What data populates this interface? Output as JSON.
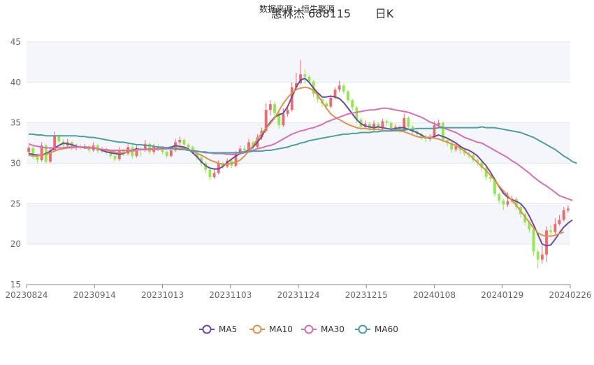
{
  "header": {
    "source_text": "数据来源：恒生聚源",
    "title": "惠林杰 688115",
    "period": "日K"
  },
  "colors": {
    "up": "#f0696c",
    "down": "#90ea4a",
    "ma5": "#6a4ba0",
    "ma10": "#e0924a",
    "ma30": "#d86eb4",
    "ma60": "#4aa0a0",
    "band": "#f5f6fb",
    "grid": "#e3e6ef",
    "axis_text": "#666666"
  },
  "chart_data": {
    "type": "candlestick",
    "title": "惠林杰 688115",
    "xlabel": "",
    "ylabel": "",
    "ylim": [
      15,
      45
    ],
    "y_ticks": [
      15,
      20,
      25,
      30,
      35,
      40,
      45
    ],
    "x_tick_labels": [
      "20230824",
      "20230914",
      "20231013",
      "20231103",
      "20231124",
      "20231215",
      "20240108",
      "20240129",
      "20240226"
    ],
    "legend": [
      "MA5",
      "MA10",
      "MA30",
      "MA60"
    ],
    "legend_position": "bottom",
    "candles": [
      [
        31.4,
        31.9,
        32.2,
        31.1
      ],
      [
        31.9,
        30.8,
        32.1,
        30.5
      ],
      [
        30.8,
        30.4,
        31.2,
        30.0
      ],
      [
        30.4,
        32.2,
        32.6,
        30.2
      ],
      [
        32.2,
        30.2,
        32.4,
        30.0
      ],
      [
        30.2,
        31.6,
        32.0,
        30.0
      ],
      [
        31.6,
        33.4,
        33.9,
        31.4
      ],
      [
        33.4,
        32.7,
        33.6,
        32.3
      ],
      [
        32.7,
        32.2,
        33.0,
        31.9
      ],
      [
        32.2,
        32.6,
        33.0,
        32.0
      ],
      [
        32.6,
        31.9,
        32.8,
        31.6
      ],
      [
        31.9,
        32.1,
        32.4,
        31.6
      ],
      [
        32.1,
        32.0,
        32.4,
        31.7
      ],
      [
        32.0,
        32.1,
        32.4,
        31.8
      ],
      [
        32.1,
        31.6,
        32.3,
        31.3
      ],
      [
        31.6,
        32.2,
        32.6,
        31.4
      ],
      [
        32.2,
        31.5,
        32.4,
        31.2
      ],
      [
        31.5,
        31.8,
        32.0,
        31.3
      ],
      [
        31.8,
        31.4,
        32.0,
        31.1
      ],
      [
        31.4,
        30.9,
        31.6,
        30.6
      ],
      [
        30.9,
        30.5,
        31.1,
        30.2
      ],
      [
        30.5,
        31.6,
        32.0,
        30.3
      ],
      [
        31.6,
        31.2,
        31.8,
        30.9
      ],
      [
        31.2,
        32.0,
        32.4,
        31.0
      ],
      [
        32.0,
        30.9,
        32.2,
        30.6
      ],
      [
        30.9,
        31.7,
        32.2,
        30.7
      ],
      [
        31.7,
        31.6,
        32.0,
        30.8
      ],
      [
        31.6,
        32.4,
        32.9,
        31.4
      ],
      [
        32.4,
        31.4,
        32.6,
        31.1
      ],
      [
        31.4,
        32.1,
        32.4,
        31.1
      ],
      [
        32.1,
        31.8,
        32.4,
        31.5
      ],
      [
        31.8,
        31.4,
        32.0,
        31.1
      ],
      [
        31.4,
        30.9,
        31.6,
        30.6
      ],
      [
        30.9,
        31.6,
        32.0,
        30.7
      ],
      [
        31.6,
        32.6,
        33.0,
        31.4
      ],
      [
        32.6,
        32.9,
        33.3,
        32.3
      ],
      [
        32.9,
        32.3,
        33.1,
        32.0
      ],
      [
        32.3,
        32.0,
        32.5,
        31.6
      ],
      [
        32.0,
        31.4,
        32.2,
        31.1
      ],
      [
        31.4,
        30.7,
        31.6,
        30.4
      ],
      [
        30.7,
        30.0,
        30.9,
        29.6
      ],
      [
        30.0,
        29.2,
        30.2,
        28.8
      ],
      [
        29.2,
        28.3,
        29.4,
        27.9
      ],
      [
        28.3,
        28.8,
        29.4,
        28.1
      ],
      [
        28.8,
        30.0,
        30.4,
        28.6
      ],
      [
        30.0,
        29.6,
        30.2,
        29.3
      ],
      [
        29.6,
        30.3,
        30.6,
        29.4
      ],
      [
        30.3,
        29.7,
        30.5,
        29.4
      ],
      [
        29.7,
        31.2,
        31.5,
        29.5
      ],
      [
        31.2,
        31.8,
        32.2,
        31.0
      ],
      [
        31.8,
        31.6,
        32.2,
        31.3
      ],
      [
        31.6,
        32.6,
        33.0,
        31.4
      ],
      [
        32.6,
        32.0,
        32.8,
        31.7
      ],
      [
        32.0,
        33.2,
        33.6,
        31.8
      ],
      [
        33.2,
        34.0,
        34.4,
        32.9
      ],
      [
        34.0,
        36.6,
        37.4,
        33.8
      ],
      [
        36.6,
        37.3,
        37.8,
        35.9
      ],
      [
        37.3,
        36.2,
        37.6,
        35.4
      ],
      [
        36.2,
        34.7,
        36.4,
        34.3
      ],
      [
        34.7,
        36.1,
        36.8,
        34.5
      ],
      [
        36.1,
        36.6,
        37.2,
        35.8
      ],
      [
        36.6,
        39.4,
        40.0,
        36.4
      ],
      [
        39.4,
        39.9,
        41.2,
        39.1
      ],
      [
        39.9,
        41.0,
        42.8,
        39.7
      ],
      [
        41.0,
        40.7,
        41.6,
        39.8
      ],
      [
        40.7,
        40.1,
        40.9,
        39.8
      ],
      [
        40.1,
        38.6,
        40.3,
        38.2
      ],
      [
        38.6,
        37.9,
        38.8,
        37.5
      ],
      [
        37.9,
        37.4,
        38.1,
        36.9
      ],
      [
        37.4,
        37.0,
        37.6,
        36.6
      ],
      [
        37.0,
        38.1,
        38.4,
        36.8
      ],
      [
        38.1,
        39.1,
        39.4,
        37.9
      ],
      [
        39.1,
        39.6,
        40.2,
        38.8
      ],
      [
        39.6,
        38.9,
        39.8,
        38.6
      ],
      [
        38.9,
        37.8,
        39.1,
        37.5
      ],
      [
        37.8,
        36.9,
        38.0,
        36.5
      ],
      [
        36.9,
        35.4,
        37.1,
        35.0
      ],
      [
        35.4,
        34.5,
        35.6,
        34.1
      ],
      [
        34.5,
        34.9,
        35.3,
        34.2
      ],
      [
        34.9,
        34.3,
        35.1,
        34.0
      ],
      [
        34.3,
        34.9,
        35.3,
        34.0
      ],
      [
        34.9,
        34.4,
        35.1,
        34.0
      ],
      [
        34.4,
        35.2,
        35.5,
        34.1
      ],
      [
        35.2,
        35.0,
        35.4,
        34.6
      ],
      [
        35.0,
        34.3,
        35.2,
        34.0
      ],
      [
        34.3,
        34.5,
        34.8,
        34.1
      ],
      [
        34.5,
        34.1,
        34.7,
        33.8
      ],
      [
        34.1,
        35.6,
        36.1,
        33.9
      ],
      [
        35.6,
        34.5,
        35.8,
        34.1
      ],
      [
        34.5,
        33.9,
        34.7,
        33.5
      ],
      [
        33.9,
        33.6,
        34.1,
        33.2
      ],
      [
        33.6,
        33.3,
        33.8,
        32.9
      ],
      [
        33.3,
        33.0,
        33.5,
        32.6
      ],
      [
        33.0,
        33.3,
        33.6,
        32.7
      ],
      [
        33.3,
        34.7,
        35.2,
        33.1
      ],
      [
        34.7,
        35.0,
        35.4,
        34.4
      ],
      [
        35.0,
        32.9,
        35.2,
        32.6
      ],
      [
        32.9,
        32.5,
        33.1,
        32.1
      ],
      [
        32.5,
        31.7,
        32.7,
        31.3
      ],
      [
        31.7,
        32.1,
        32.4,
        31.4
      ],
      [
        32.1,
        31.6,
        32.3,
        31.2
      ],
      [
        31.6,
        31.2,
        31.8,
        30.9
      ],
      [
        31.2,
        31.0,
        31.4,
        30.6
      ],
      [
        31.0,
        30.4,
        31.2,
        30.1
      ],
      [
        30.4,
        30.1,
        30.6,
        29.7
      ],
      [
        30.1,
        29.4,
        30.3,
        29.0
      ],
      [
        29.4,
        28.3,
        29.6,
        27.9
      ],
      [
        28.3,
        28.1,
        28.5,
        27.7
      ],
      [
        28.1,
        26.2,
        28.3,
        25.9
      ],
      [
        26.2,
        25.4,
        26.4,
        25.0
      ],
      [
        25.4,
        24.9,
        25.6,
        24.2
      ],
      [
        24.9,
        25.3,
        26.4,
        24.6
      ],
      [
        25.3,
        25.6,
        26.0,
        25.1
      ],
      [
        25.6,
        24.6,
        25.8,
        24.2
      ],
      [
        24.6,
        23.7,
        24.8,
        23.3
      ],
      [
        23.7,
        22.7,
        23.9,
        22.3
      ],
      [
        22.7,
        21.8,
        22.9,
        21.4
      ],
      [
        21.8,
        19.1,
        22.0,
        18.6
      ],
      [
        19.1,
        18.1,
        19.3,
        17.0
      ],
      [
        18.1,
        18.7,
        19.8,
        17.6
      ],
      [
        18.7,
        21.7,
        22.2,
        17.8
      ],
      [
        21.7,
        21.5,
        22.4,
        21.1
      ],
      [
        21.5,
        22.5,
        23.2,
        21.2
      ],
      [
        22.5,
        23.0,
        23.6,
        22.3
      ],
      [
        23.0,
        24.2,
        24.6,
        22.8
      ],
      [
        24.2,
        24.4,
        24.8,
        23.9
      ]
    ],
    "series": [
      {
        "name": "MA5",
        "values": [
          31.2,
          31.1,
          31.0,
          31.0,
          31.2,
          31.5,
          31.9,
          32.2,
          32.5,
          32.4,
          32.3,
          32.1,
          32.0,
          31.9,
          31.9,
          31.9,
          31.8,
          31.6,
          31.4,
          31.3,
          31.2,
          31.1,
          31.2,
          31.5,
          31.6,
          31.8,
          31.7,
          31.7,
          31.7,
          31.7,
          31.8,
          31.8,
          31.9,
          32.0,
          32.2,
          32.1,
          32.0,
          31.8,
          31.3,
          30.8,
          30.2,
          29.7,
          29.4,
          29.3,
          29.3,
          29.6,
          30.1,
          30.5,
          30.9,
          31.2,
          31.4,
          31.6,
          32.0,
          32.6,
          33.3,
          34.3,
          35.1,
          35.7,
          36.0,
          36.2,
          37.0,
          38.2,
          39.4,
          40.3,
          40.5,
          40.0,
          39.3,
          38.7,
          38.2,
          38.2,
          38.3,
          38.2,
          38.0,
          37.5,
          36.8,
          36.1,
          35.4,
          34.9,
          34.6,
          34.5,
          34.4,
          34.5,
          34.4,
          34.3,
          34.2,
          34.3,
          34.4,
          34.4,
          34.2,
          34.0,
          33.8,
          33.5,
          33.2,
          33.1,
          33.3,
          33.5,
          33.3,
          33.1,
          32.8,
          32.5,
          32.1,
          31.8,
          31.6,
          31.3,
          30.9,
          30.3,
          29.7,
          28.9,
          28.0,
          27.1,
          26.3,
          25.8,
          25.5,
          25.3,
          25.0,
          24.4,
          23.5,
          22.4,
          21.2,
          20.0,
          19.8,
          19.9,
          20.6,
          21.4,
          22.1,
          22.6,
          23.0
        ]
      },
      {
        "name": "MA10",
        "values": [
          31.0,
          30.9,
          30.9,
          31.0,
          31.1,
          31.3,
          31.5,
          31.7,
          31.8,
          31.9,
          31.9,
          32.0,
          32.0,
          32.0,
          32.0,
          31.9,
          31.8,
          31.7,
          31.6,
          31.5,
          31.4,
          31.3,
          31.3,
          31.4,
          31.5,
          31.6,
          31.7,
          31.7,
          31.7,
          31.7,
          31.7,
          31.8,
          31.8,
          31.9,
          31.9,
          31.9,
          31.8,
          31.7,
          31.5,
          31.2,
          31.0,
          30.7,
          30.4,
          30.2,
          30.0,
          29.9,
          29.9,
          30.0,
          30.1,
          30.4,
          30.9,
          31.5,
          32.2,
          33.0,
          33.7,
          34.3,
          34.9,
          35.6,
          36.5,
          37.4,
          38.1,
          38.7,
          39.1,
          39.3,
          39.4,
          39.3,
          39.0,
          38.4,
          37.6,
          36.8,
          36.1,
          35.7,
          35.4,
          35.1,
          34.8,
          34.6,
          34.4,
          34.3,
          34.3,
          34.2,
          34.2,
          34.2,
          34.1,
          34.0,
          34.0,
          34.0,
          34.0,
          33.9,
          33.7,
          33.5,
          33.3,
          33.2,
          33.2,
          33.2,
          33.1,
          33.0,
          32.8,
          32.6,
          32.4,
          32.2,
          31.9,
          31.5,
          31.1,
          30.6,
          30.1,
          29.6,
          29.1,
          28.5,
          27.9,
          27.2,
          26.6,
          26.0,
          25.4,
          24.8,
          24.1,
          23.4,
          22.7,
          22.0,
          21.4,
          21.1,
          21.0,
          21.0,
          21.1,
          21.3,
          21.5
        ]
      },
      {
        "name": "MA30",
        "values": [
          32.4,
          32.2,
          32.1,
          32.0,
          31.9,
          31.9,
          31.9,
          31.9,
          31.9,
          32.0,
          32.0,
          32.0,
          32.0,
          32.0,
          31.9,
          31.9,
          31.8,
          31.7,
          31.7,
          31.6,
          31.6,
          31.6,
          31.6,
          31.6,
          31.6,
          31.7,
          31.7,
          31.7,
          31.8,
          31.8,
          31.8,
          31.8,
          31.8,
          31.8,
          31.8,
          31.7,
          31.7,
          31.6,
          31.6,
          31.5,
          31.4,
          31.3,
          31.3,
          31.2,
          31.2,
          31.2,
          31.1,
          31.1,
          31.1,
          31.2,
          31.3,
          31.5,
          31.6,
          31.8,
          31.9,
          32.1,
          32.2,
          32.4,
          32.7,
          33.0,
          33.3,
          33.6,
          33.8,
          34.0,
          34.1,
          34.3,
          34.4,
          34.6,
          34.8,
          35.1,
          35.3,
          35.5,
          35.7,
          35.9,
          36.1,
          36.2,
          36.3,
          36.4,
          36.5,
          36.6,
          36.6,
          36.7,
          36.8,
          36.8,
          36.7,
          36.6,
          36.5,
          36.4,
          36.3,
          36.1,
          35.9,
          35.7,
          35.4,
          35.1,
          34.9,
          34.6,
          34.4,
          34.2,
          34.0,
          33.8,
          33.5,
          33.2,
          33.0,
          32.8,
          32.6,
          32.5,
          32.2,
          31.9,
          31.6,
          31.3,
          31.0,
          30.7,
          30.3,
          30.0,
          29.6,
          29.2,
          28.8,
          28.3,
          27.9,
          27.5,
          27.2,
          26.8,
          26.4,
          26.0,
          25.8,
          25.6,
          25.4
        ]
      },
      {
        "name": "MA60",
        "values": [
          33.6,
          33.6,
          33.5,
          33.5,
          33.4,
          33.4,
          33.4,
          33.4,
          33.4,
          33.4,
          33.4,
          33.4,
          33.3,
          33.3,
          33.2,
          33.2,
          33.1,
          33.0,
          32.9,
          32.8,
          32.7,
          32.6,
          32.6,
          32.5,
          32.4,
          32.3,
          32.3,
          32.2,
          32.2,
          32.1,
          32.0,
          32.0,
          31.9,
          31.9,
          31.8,
          31.7,
          31.7,
          31.6,
          31.5,
          31.5,
          31.4,
          31.4,
          31.3,
          31.3,
          31.3,
          31.3,
          31.3,
          31.3,
          31.3,
          31.4,
          31.4,
          31.4,
          31.5,
          31.5,
          31.5,
          31.6,
          31.6,
          31.7,
          31.8,
          31.9,
          32.0,
          32.2,
          32.3,
          32.5,
          32.6,
          32.8,
          32.9,
          33.0,
          33.1,
          33.2,
          33.3,
          33.4,
          33.5,
          33.6,
          33.6,
          33.7,
          33.7,
          33.8,
          33.8,
          33.8,
          33.9,
          33.9,
          34.0,
          34.0,
          34.0,
          34.1,
          34.1,
          34.1,
          34.2,
          34.2,
          34.3,
          34.3,
          34.3,
          34.3,
          34.3,
          34.4,
          34.4,
          34.4,
          34.4,
          34.4,
          34.4,
          34.4,
          34.4,
          34.4,
          34.4,
          34.5,
          34.4,
          34.4,
          34.4,
          34.3,
          34.2,
          34.1,
          34.0,
          33.9,
          33.8,
          33.6,
          33.4,
          33.2,
          32.9,
          32.6,
          32.3,
          32.0,
          31.7,
          31.3,
          30.9,
          30.6,
          30.2,
          30.0
        ]
      }
    ]
  }
}
